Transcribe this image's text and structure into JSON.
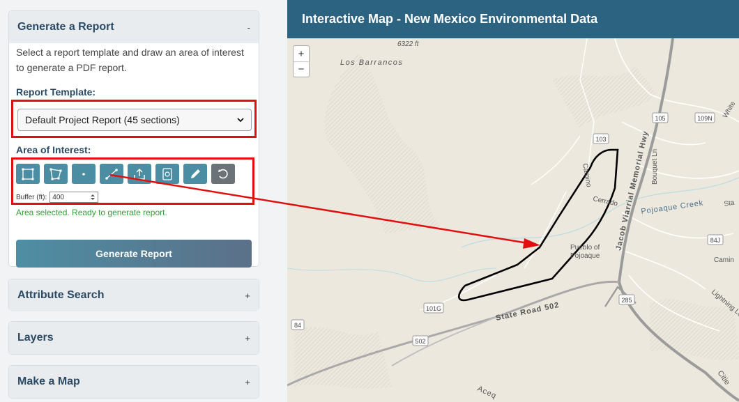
{
  "sidebar": {
    "report": {
      "title": "Generate a Report",
      "toggle": "-",
      "description": "Select a report template and draw an area of interest to generate a PDF report.",
      "template_label": "Report Template:",
      "template_value": "Default Project Report (45 sections)",
      "aoi_label": "Area of Interest:",
      "tools": [
        "rectangle-tool",
        "polygon-tool",
        "point-tool",
        "line-tool",
        "upload-tool",
        "saved-area-tool",
        "draw-tool",
        "reset-tool"
      ],
      "buffer_label": "Buffer (ft):",
      "buffer_value": "400",
      "status": "Area selected. Ready to generate report.",
      "generate_button": "Generate Report"
    },
    "attribute_search": {
      "title": "Attribute Search",
      "toggle": "+"
    },
    "layers": {
      "title": "Layers",
      "toggle": "+"
    },
    "make_map": {
      "title": "Make a Map",
      "toggle": "+"
    }
  },
  "map": {
    "title": "Interactive Map - New Mexico Environmental Data",
    "zoom_in": "+",
    "zoom_out": "−",
    "labels": {
      "elevation": "6322 ft",
      "los_barrancos": "Los Barrancos",
      "camino_cerrado_1": "Camino",
      "camino_cerrado_2": "Cerrado",
      "pojoaque_creek": "Pojoaque Creek",
      "pueblo_1": "Pueblo of",
      "pueblo_2": "Pojoaque",
      "hwy": "Jacob Viarrial Memorial Hwy",
      "bouquet": "Bouquet Ln",
      "state_road": "State Road 502",
      "camino_r": "Camin",
      "lightning": "Lightning Loo",
      "white": "White",
      "acequia": "Aceq",
      "cities": "Citie",
      "sta": "Sta"
    },
    "shields": [
      "105",
      "109N",
      "103",
      "84J",
      "101G",
      "285",
      "84",
      "502"
    ]
  },
  "colors": {
    "accent": "#2c6380",
    "highlight": "#e01010",
    "status": "#2fa036"
  }
}
